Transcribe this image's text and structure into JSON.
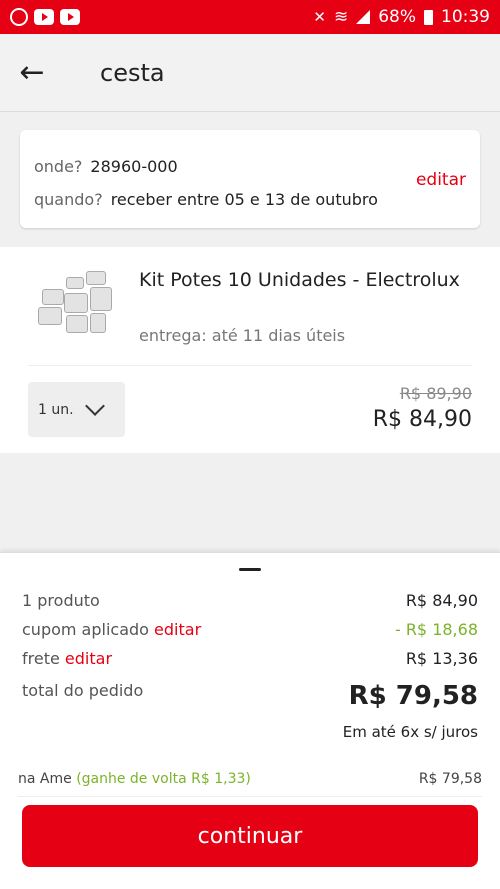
{
  "status_bar": {
    "battery": "68%",
    "time": "10:39"
  },
  "header": {
    "title": "cesta"
  },
  "delivery": {
    "where_label": "onde?",
    "where_value": "28960-000",
    "when_label": "quando?",
    "when_value": "receber entre 05 e 13 de outubro",
    "edit_label": "editar"
  },
  "product": {
    "name": "Kit Potes 10 Unidades - Electrolux",
    "delivery": "entrega: até 11 dias úteis",
    "quantity": "1 un.",
    "old_price": "R$ 89,90",
    "price": "R$ 84,90"
  },
  "summary": {
    "products_label": "1 produto",
    "products_value": "R$ 84,90",
    "coupon_label": "cupom aplicado",
    "coupon_edit": "editar",
    "coupon_value": "- R$ 18,68",
    "shipping_label": "frete",
    "shipping_edit": "editar",
    "shipping_value": "R$ 13,36",
    "total_label": "total do pedido",
    "total_value": "R$ 79,58",
    "installments": "Em até 6x s/ juros",
    "ame_label": "na Ame",
    "ame_cashback": "(ganhe de volta R$ 1,33)",
    "ame_value": "R$ 79,58",
    "continue_label": "continuar"
  },
  "colors": {
    "brand": "#e60014",
    "green": "#7cb32a"
  }
}
